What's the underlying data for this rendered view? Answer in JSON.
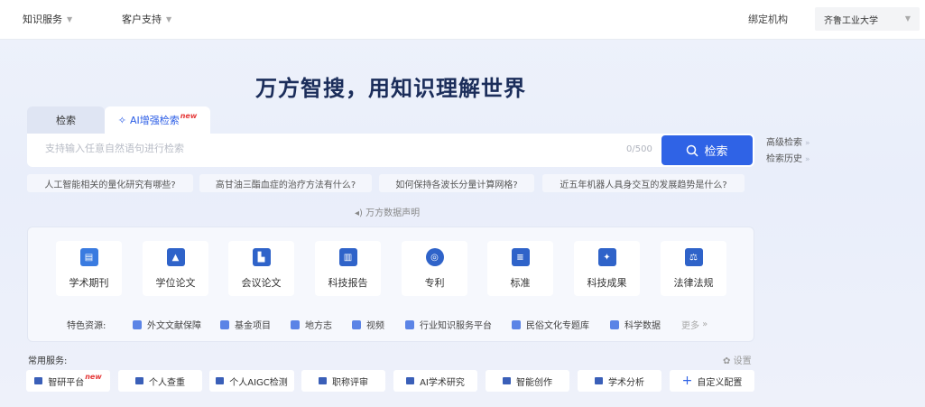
{
  "nav": {
    "knowledge": "知识服务",
    "support": "客户支持",
    "org_label": "绑定机构",
    "org_value": "齐鲁工业大学"
  },
  "headline": "万方智搜，用知识理解世界",
  "tabs": {
    "search": "检索",
    "ai": "AI增强检索",
    "new_badge": "new"
  },
  "search": {
    "placeholder": "支持输入任意自然语句进行检索",
    "counter": "0/500",
    "button": "检索"
  },
  "side_links": {
    "advanced": "高级检索",
    "history": "检索历史"
  },
  "suggestions": [
    "人工智能相关的量化研究有哪些?",
    "高甘油三酯血症的治疗方法有什么?",
    "如何保持各波长分量计算网格?",
    "近五年机器人具身交互的发展趋势是什么?"
  ],
  "disclaimer": "万方数据声明",
  "resources": [
    {
      "label": "学术期刊",
      "icon": "journal-icon",
      "color": "#3a7be0"
    },
    {
      "label": "学位论文",
      "icon": "graduation-cap-icon",
      "color": "#2f63c9"
    },
    {
      "label": "会议论文",
      "icon": "conference-icon",
      "color": "#2f63c9"
    },
    {
      "label": "科技报告",
      "icon": "report-icon",
      "color": "#2f63c9"
    },
    {
      "label": "专利",
      "icon": "patent-medal-icon",
      "color": "#2f63c9"
    },
    {
      "label": "标准",
      "icon": "standard-icon",
      "color": "#2f63c9"
    },
    {
      "label": "科技成果",
      "icon": "achievement-icon",
      "color": "#2f63c9"
    },
    {
      "label": "法律法规",
      "icon": "law-icon",
      "color": "#2f63c9"
    }
  ],
  "features": {
    "label": "特色资源:",
    "items": [
      "外文文献保障",
      "基金项目",
      "地方志",
      "视频",
      "行业知识服务平台",
      "民俗文化专题库",
      "科学数据"
    ],
    "more": "更多"
  },
  "services": {
    "title": "常用服务:",
    "settings": "设置",
    "items": [
      "智研平台",
      "个人查重",
      "个人AIGC检测",
      "职称评审",
      "AI学术研究",
      "智能创作",
      "学术分析"
    ],
    "custom": "自定义配置"
  }
}
